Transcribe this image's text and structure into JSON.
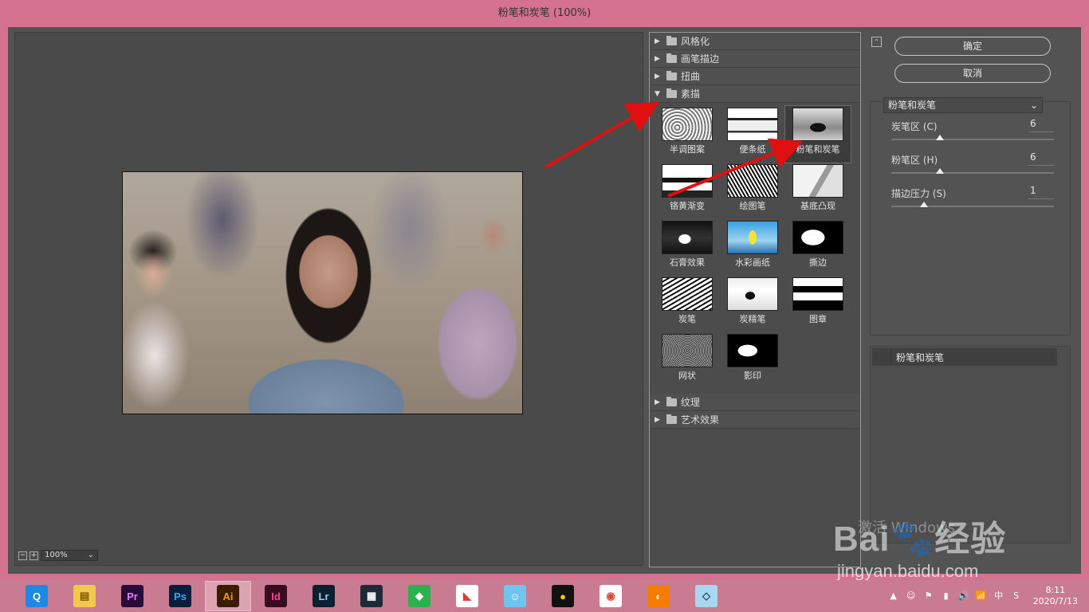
{
  "window": {
    "title": "粉笔和炭笔 (100%)"
  },
  "preview": {
    "zoom": "100%",
    "zoom_out": "−",
    "zoom_in": "+",
    "chevron": "⌄"
  },
  "gallery": {
    "categories_top": [
      {
        "label": "风格化",
        "expanded": false
      },
      {
        "label": "画笔描边",
        "expanded": false
      },
      {
        "label": "扭曲",
        "expanded": false
      },
      {
        "label": "素描",
        "expanded": true
      }
    ],
    "sketch_filters": [
      "半调图案",
      "便条纸",
      "粉笔和炭笔",
      "铬黄渐变",
      "绘图笔",
      "基底凸现",
      "石膏效果",
      "水彩画纸",
      "撕边",
      "炭笔",
      "炭精笔",
      "图章",
      "网状",
      "影印"
    ],
    "selected_filter": "粉笔和炭笔",
    "categories_bottom": [
      {
        "label": "纹理",
        "expanded": false
      },
      {
        "label": "艺术效果",
        "expanded": false
      }
    ],
    "arrow_collapsed": "▶",
    "arrow_expanded": "▼"
  },
  "panel": {
    "collapse_glyph": "⌃",
    "ok_label": "确定",
    "cancel_label": "取消",
    "filter_select": "粉笔和炭笔",
    "select_chevron": "⌄",
    "params": [
      {
        "label": "炭笔区 (C)",
        "value": "6",
        "fraction": 0.3
      },
      {
        "label": "粉笔区 (H)",
        "value": "6",
        "fraction": 0.3
      },
      {
        "label": "描边压力 (S)",
        "value": "1",
        "fraction": 0.2
      }
    ],
    "layer_name": "粉笔和炭笔"
  },
  "watermark": {
    "line1": "Bai🐾经验",
    "line2": "jingyan.baidu.com",
    "activate": "激活 Windows"
  },
  "taskbar": {
    "apps": [
      {
        "name": "qq-browser",
        "label": "Q",
        "bg": "#1e88e5",
        "fg": "#fff"
      },
      {
        "name": "file-explorer",
        "label": "▤",
        "bg": "#f2c94c",
        "fg": "#7a5a00"
      },
      {
        "name": "premiere",
        "label": "Pr",
        "bg": "#2a0a3a",
        "fg": "#e77bff"
      },
      {
        "name": "photoshop",
        "label": "Ps",
        "bg": "#061e3a",
        "fg": "#31a8ff"
      },
      {
        "name": "illustrator",
        "label": "Ai",
        "bg": "#3a1c00",
        "fg": "#ff9a00"
      },
      {
        "name": "indesign",
        "label": "Id",
        "bg": "#3a0a1e",
        "fg": "#ff3f9a"
      },
      {
        "name": "lightroom",
        "label": "Lr",
        "bg": "#0a2030",
        "fg": "#8fd0f0"
      },
      {
        "name": "video-editor",
        "label": "▦",
        "bg": "#1c2a3a",
        "fg": "#fff"
      },
      {
        "name": "green-app",
        "label": "◆",
        "bg": "#2bb24c",
        "fg": "#fff"
      },
      {
        "name": "game-app",
        "label": "◣",
        "bg": "#ffffff",
        "fg": "#e53935"
      },
      {
        "name": "chat-app",
        "label": "☺",
        "bg": "#6ec6f0",
        "fg": "#fff"
      },
      {
        "name": "qq",
        "label": "●",
        "bg": "#111111",
        "fg": "#ffcc00"
      },
      {
        "name": "chrome",
        "label": "◉",
        "bg": "#ffffff",
        "fg": "#db4437"
      },
      {
        "name": "foxmail",
        "label": "◐",
        "bg": "#f57c00",
        "fg": "#fff"
      },
      {
        "name": "notes-app",
        "label": "◇",
        "bg": "#a8d8f0",
        "fg": "#1a4a6a"
      }
    ],
    "active_app": "illustrator",
    "tray": [
      "▲",
      "☺",
      "⚑",
      "▮",
      "🔊",
      "📶",
      "中",
      "S"
    ],
    "time": "8:11",
    "date": "2020/7/13"
  }
}
